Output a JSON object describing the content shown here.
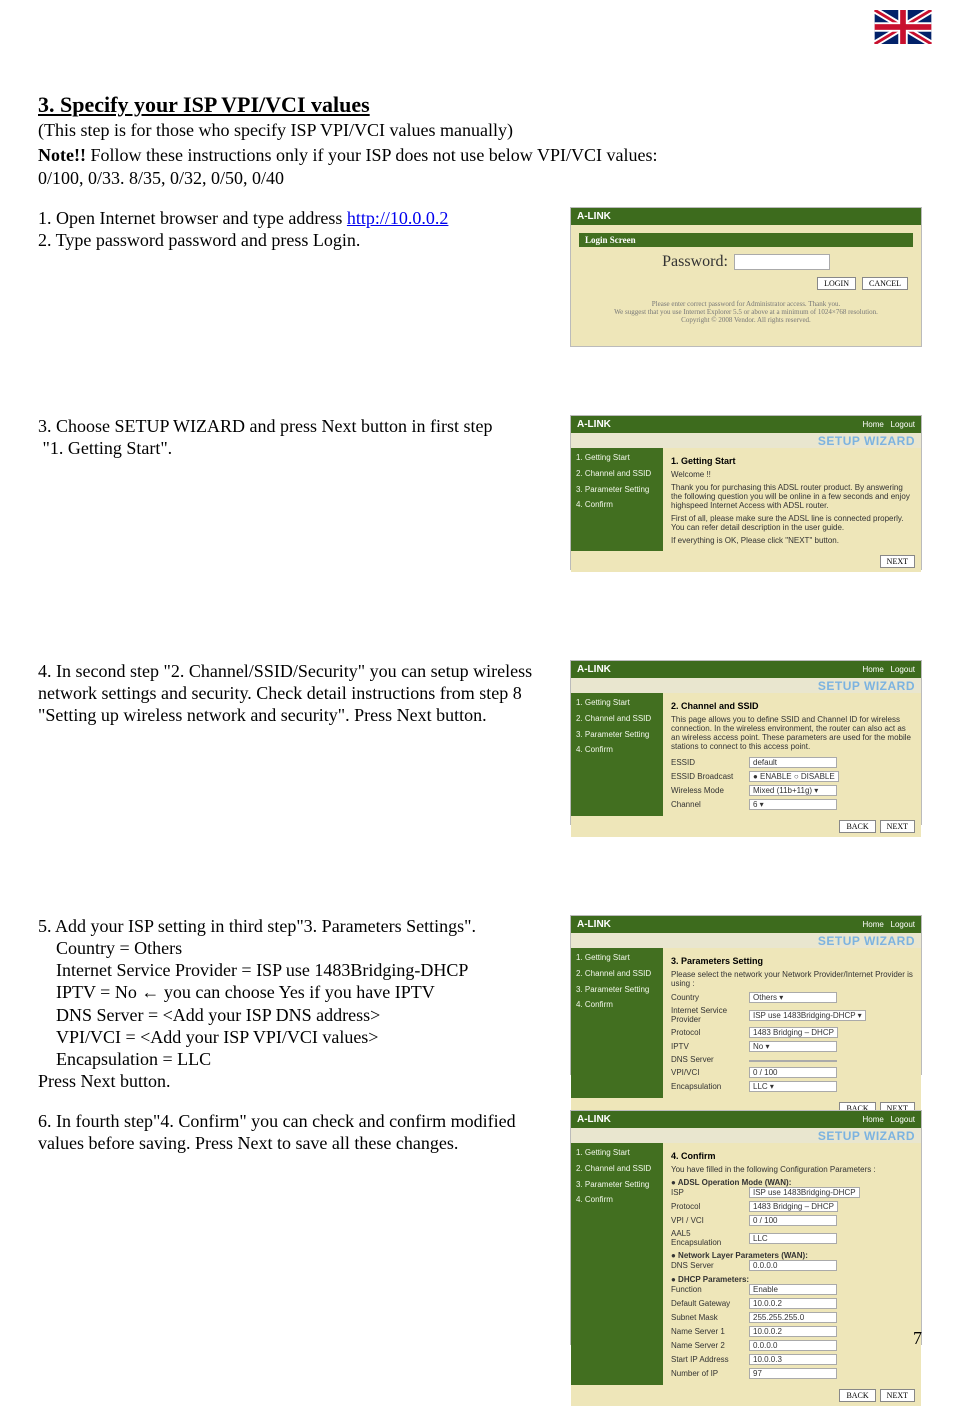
{
  "title": "3.  Specify your ISP VPI/VCI values",
  "subtitle": "(This step is for those who specify ISP VPI/VCI values manually)",
  "note_label": "Note!!",
  "note_text": " Follow these instructions only if your ISP does not use below VPI/VCI values:",
  "vpi_values": "0/100, 0/33. 8/35, 0/32, 0/50, 0/40",
  "step1_a": "1. Open Internet browser and type address ",
  "step1_link": "http://10.0.0.2",
  "step2": "2. Type password password and press Login.",
  "step3_a": "3. Choose SETUP WIZARD and press Next button in first step ",
  "step3_b": "\"1. Getting Start\".",
  "step4_a": "4. In second step \"2. Channel/SSID/Security\" you can setup wireless network settings and security. Check detail instructions from step 8 \"Setting up wireless network and security\". Press Next button.",
  "step5_a": "5. Add your ISP setting in third step\"3. Parameters Settings\".",
  "step5_lines": [
    "Country = Others",
    "Internet Service Provider = ISP use 1483Bridging-DHCP",
    "IPTV = No     ← you can choose Yes if you have IPTV",
    "DNS Server = <Add your ISP DNS address>",
    "VPI/VCI = <Add your ISP VPI/VCI values>",
    "Encapsulation = LLC"
  ],
  "step5_press": "Press Next button.",
  "step6": "6. In fourth step\"4. Confirm\" you can check and confirm modified values before saving. Press Next to save all these changes.",
  "page_num": "7",
  "shot_brand": "A-LINK",
  "shot_wiz_header": "SETUP WIZARD",
  "shot_home": "Home",
  "shot_logout": "Logout",
  "shot_side": [
    "1. Getting Start",
    "2. Channel and SSID",
    "3. Parameter Setting",
    "4. Confirm"
  ],
  "login": {
    "bar": "Login Screen",
    "pw_label": "Password:",
    "btn_login": "LOGIN",
    "btn_cancel": "CANCEL",
    "foot1": "Please enter correct password for Administrator access. Thank you.",
    "foot2": "We suggest that you use Internet Explorer 5.5 or above at a minimum of 1024×768 resolution.",
    "foot3": "Copyright © 2008 Vendor. All rights reserved."
  },
  "s2": {
    "title": "1. Getting Start",
    "l1": "Welcome !!",
    "l2": "Thank you for purchasing this ADSL router product. By answering the following question you will be online in a few seconds and enjoy highspeed Internet Access with ADSL router.",
    "l3": "First of all, please make sure the ADSL line is connected properly. You can refer detail description in the user guide.",
    "l4": "If everything is OK, Please click \"NEXT\" button.",
    "next": "NEXT"
  },
  "s3": {
    "title": "2. Channel and SSID",
    "desc": "This page allows you to define SSID and Channel ID for wireless connection. In the wireless environment, the router can also act as an wireless access point. These parameters are used for the mobile stations to connect to this access point.",
    "rows": [
      [
        "ESSID",
        "default"
      ],
      [
        "ESSID Broadcast",
        "● ENABLE   ○ DISABLE"
      ],
      [
        "Wireless Mode",
        "Mixed (11b+11g) ▾"
      ],
      [
        "Channel",
        "6   ▾"
      ]
    ],
    "back": "BACK",
    "next": "NEXT"
  },
  "s4": {
    "title": "3. Parameters Setting",
    "desc": "Please select the network your Network Provider/Internet Provider is using :",
    "rows": [
      [
        "Country",
        "Others ▾"
      ],
      [
        "Internet Service Provider",
        "ISP use 1483Bridging-DHCP ▾"
      ],
      [
        "Protocol",
        "1483 Bridging – DHCP"
      ],
      [
        "IPTV",
        "No ▾"
      ],
      [
        "DNS Server",
        ""
      ],
      [
        "VPI/VCI",
        "0  / 100"
      ],
      [
        "Encapsulation",
        "LLC ▾"
      ]
    ],
    "back": "BACK",
    "next": "NEXT"
  },
  "s5": {
    "title": "4. Confirm",
    "desc": "You have filled in the following Configuration Parameters :",
    "sec1": "● ADSL Operation Mode (WAN):",
    "rows1": [
      [
        "ISP",
        "ISP use 1483Bridging-DHCP"
      ],
      [
        "Protocol",
        "1483 Bridging – DHCP"
      ],
      [
        "VPI / VCI",
        "0 / 100"
      ],
      [
        "AAL5 Encapsulation",
        "LLC"
      ]
    ],
    "sec2": "● Network Layer Parameters (WAN):",
    "rows2": [
      [
        "DNS Server",
        "0.0.0.0"
      ]
    ],
    "sec3": "● DHCP Parameters:",
    "rows3": [
      [
        "Function",
        "Enable"
      ],
      [
        "Default Gateway",
        "10.0.0.2"
      ],
      [
        "Subnet Mask",
        "255.255.255.0"
      ],
      [
        "Name Server 1",
        "10.0.0.2"
      ],
      [
        "Name Server 2",
        "0.0.0.0"
      ],
      [
        "Start IP Address",
        "10.0.0.3"
      ],
      [
        "Number of IP",
        "97"
      ]
    ],
    "back": "BACK",
    "next": "NEXT"
  }
}
